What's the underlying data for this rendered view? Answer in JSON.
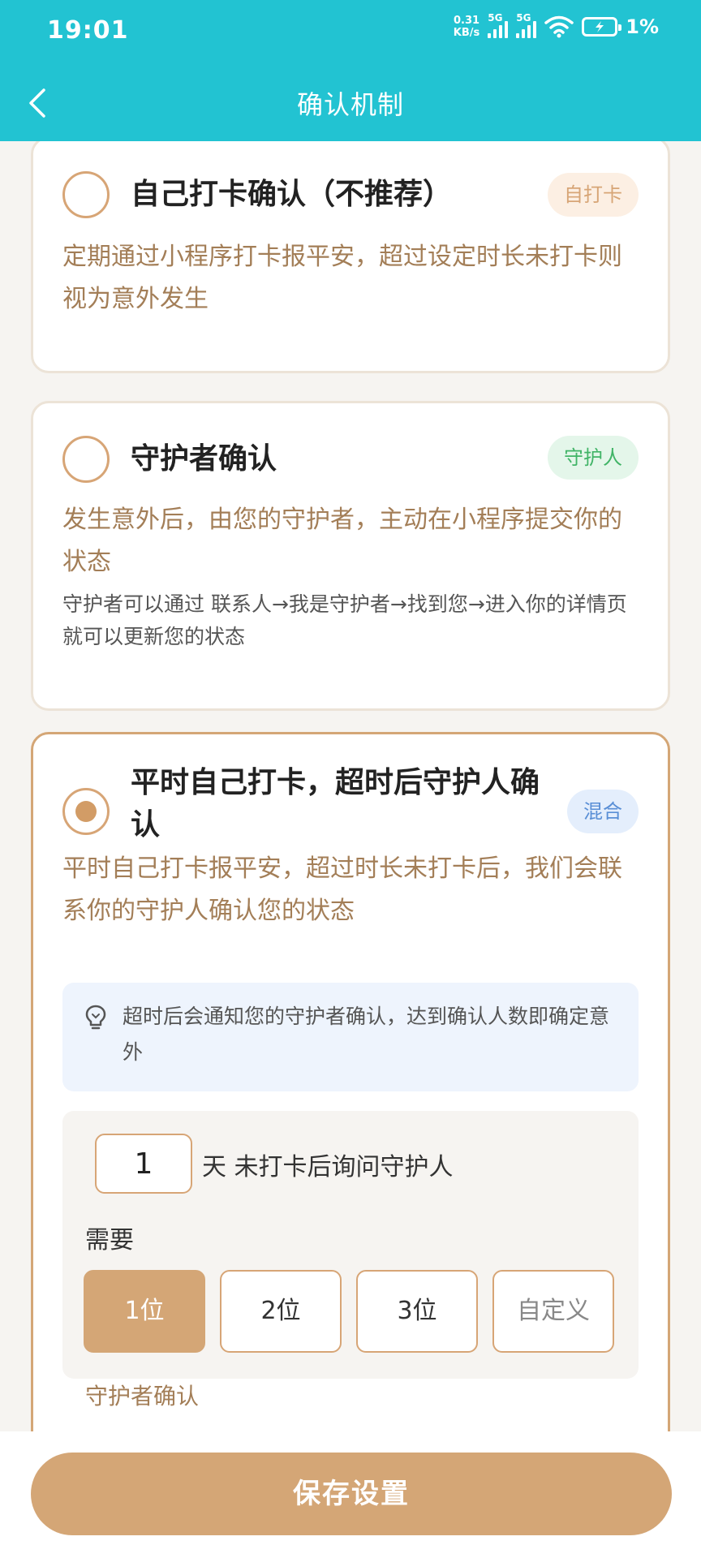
{
  "status_bar": {
    "time": "19:01",
    "net_speed_value": "0.31",
    "net_speed_unit": "KB/s",
    "sig1_tag": "5G",
    "sig2_tag": "5G",
    "battery": "1%"
  },
  "nav": {
    "title": "确认机制",
    "back_icon": "chevron-left-icon"
  },
  "options": [
    {
      "title": "自己打卡确认（不推荐）",
      "badge": "自打卡",
      "desc": "定期通过小程序打卡报平安，超过设定时长未打卡则视为意外发生",
      "selected": false
    },
    {
      "title": "守护者确认",
      "badge": "守护人",
      "desc": "发生意外后，由您的守护者，主动在小程序提交你的状态",
      "note": "守护者可以通过 联系人→我是守护者→找到您→进入你的详情页就可以更新您的状态",
      "selected": false
    },
    {
      "title": "平时自己打卡，超时后守护人确认",
      "badge": "混合",
      "desc": "平时自己打卡报平安，超过时长未打卡后，我们会联系你的守护人确认您的状态",
      "selected": true
    }
  ],
  "tip": {
    "icon": "lightbulb-icon",
    "text": "超时后会通知您的守护者确认，达到确认人数即确定意外"
  },
  "settings": {
    "days_value": "1",
    "days_suffix": "天  未打卡后询问守护人",
    "need_label": "需要",
    "count_options": [
      "1位",
      "2位",
      "3位",
      "自定义"
    ],
    "selected_count": "1位",
    "confirm_label": "守护者确认"
  },
  "footer": {
    "save_label": "保存设置"
  },
  "colors": {
    "header": "#22c3d2",
    "accent": "#d4a676",
    "desc_text": "#a37e57"
  }
}
